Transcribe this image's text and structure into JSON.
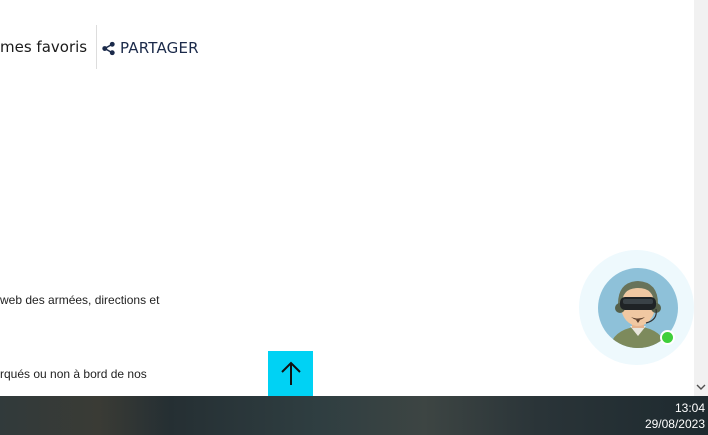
{
  "favorites": {
    "label": "mes favoris"
  },
  "share": {
    "label": "PARTAGER",
    "icon": "share-icon"
  },
  "content": {
    "line1": "web des armées, directions et",
    "line2": "rqués ou non à bord de nos"
  },
  "back_to_top": {
    "icon": "arrow-up-icon",
    "color": "#00d2f4"
  },
  "chat": {
    "avatar_icon": "pilot-avatar-icon",
    "status": "online",
    "status_color": "#3fcf3a"
  },
  "taskbar": {
    "time": "13:04",
    "date": "29/08/2023"
  },
  "scrollbar": {
    "icon": "chevron-down-icon"
  }
}
